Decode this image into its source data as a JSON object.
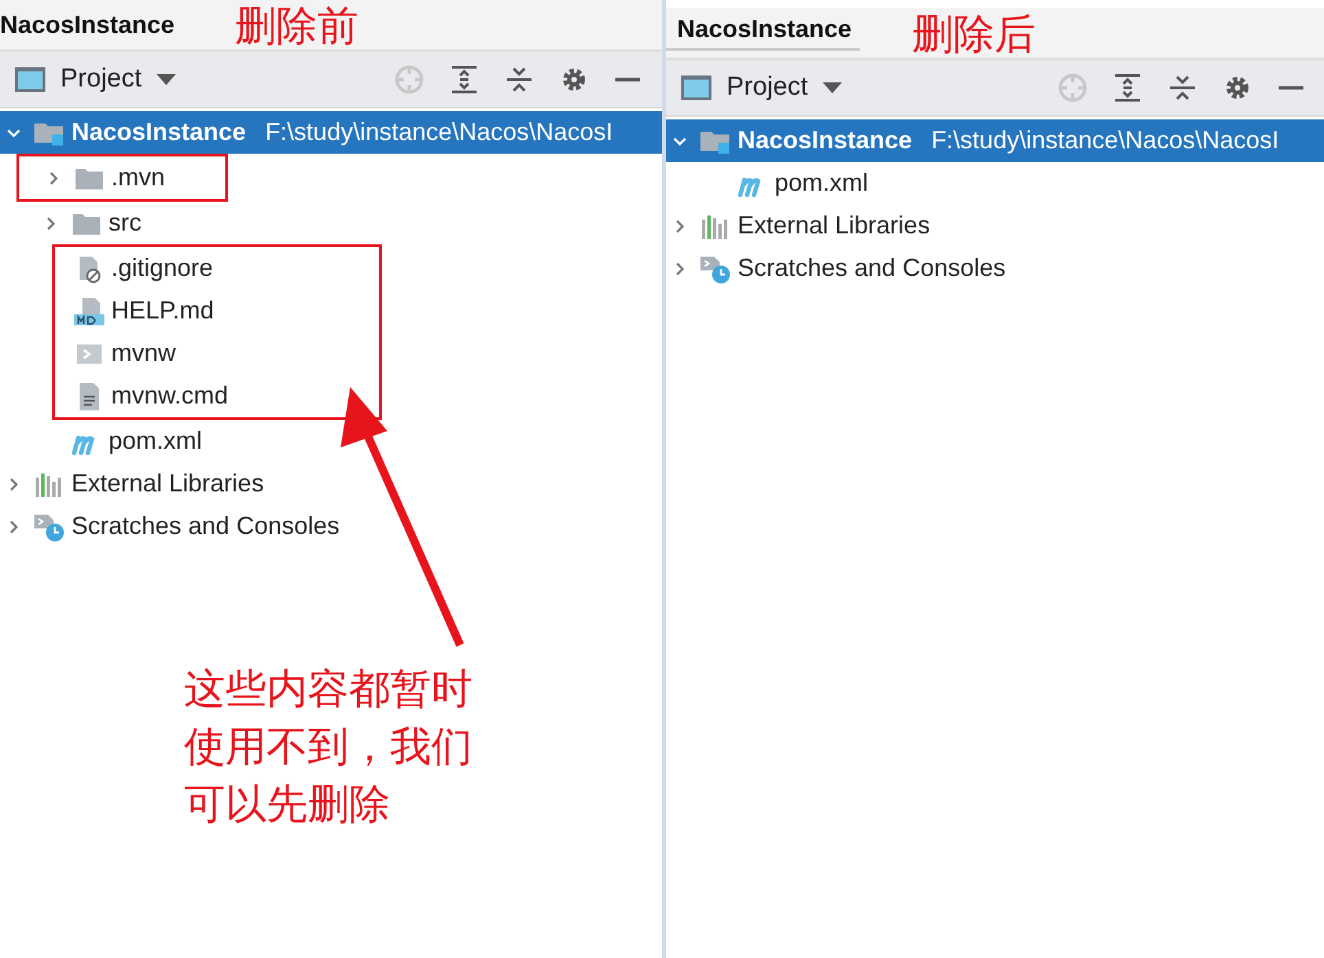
{
  "panels": [
    {
      "title": "NacosInstance",
      "caption": "删除前",
      "tool": "Project",
      "tree": [
        {
          "label": "NacosInstance",
          "path": "F:\\study\\instance\\Nacos\\NacosI",
          "kind": "module",
          "expanded": true,
          "selected": true,
          "marked": false,
          "children": [
            {
              "label": ".mvn",
              "kind": "folder",
              "expanded": false,
              "selected": false,
              "marked": true
            },
            {
              "label": "src",
              "kind": "folder",
              "expanded": false,
              "selected": false,
              "marked": false
            },
            {
              "label": ".gitignore",
              "kind": "ignore",
              "selected": false,
              "marked": true
            },
            {
              "label": "HELP.md",
              "kind": "markdown",
              "selected": false,
              "marked": true
            },
            {
              "label": "mvnw",
              "kind": "script",
              "selected": false,
              "marked": true
            },
            {
              "label": "mvnw.cmd",
              "kind": "text",
              "selected": false,
              "marked": true
            },
            {
              "label": "pom.xml",
              "kind": "maven",
              "selected": false,
              "marked": false
            }
          ]
        },
        {
          "label": "External Libraries",
          "kind": "libraries",
          "expanded": false,
          "selected": false,
          "marked": false
        },
        {
          "label": "Scratches and Consoles",
          "kind": "scratches",
          "expanded": false,
          "selected": false,
          "marked": false
        }
      ],
      "note": "这些内容都暂时使用不到，我们可以先删除"
    },
    {
      "title": "NacosInstance",
      "caption": "删除后",
      "tool": "Project",
      "tree": [
        {
          "label": "NacosInstance",
          "path": "F:\\study\\instance\\Nacos\\NacosI",
          "kind": "module",
          "expanded": true,
          "selected": true,
          "marked": false,
          "children": [
            {
              "label": "pom.xml",
              "kind": "maven",
              "selected": false,
              "marked": false
            }
          ]
        },
        {
          "label": "External Libraries",
          "kind": "libraries",
          "expanded": false,
          "selected": false,
          "marked": false
        },
        {
          "label": "Scratches and Consoles",
          "kind": "scratches",
          "expanded": false,
          "selected": false,
          "marked": false
        }
      ]
    }
  ]
}
